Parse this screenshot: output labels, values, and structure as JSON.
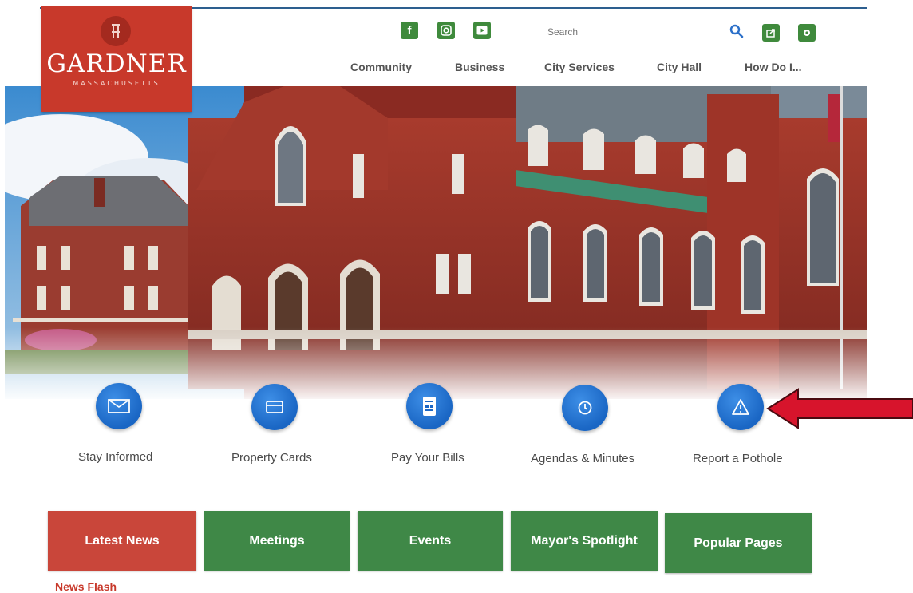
{
  "logo": {
    "name": "GARDNER",
    "state": "MASSACHUSETTS"
  },
  "social": [
    {
      "icon": "facebook-icon",
      "glyph": "f"
    },
    {
      "icon": "instagram-icon",
      "glyph": "◙"
    },
    {
      "icon": "youtube-icon",
      "glyph": "▶"
    }
  ],
  "search": {
    "placeholder": "Search"
  },
  "nav": [
    "Community",
    "Business",
    "City Services",
    "City Hall",
    "How Do I..."
  ],
  "quick_links": [
    {
      "label": "Stay Informed",
      "icon": "envelope-icon"
    },
    {
      "label": "Property Cards",
      "icon": "card-icon"
    },
    {
      "label": "Pay Your Bills",
      "icon": "bill-icon"
    },
    {
      "label": "Agendas & Minutes",
      "icon": "clock-icon"
    },
    {
      "label": "Report a Pothole",
      "icon": "warning-icon"
    }
  ],
  "tabs": [
    "Latest News",
    "Meetings",
    "Events",
    "Mayor's Spotlight",
    "Popular Pages"
  ],
  "news_flash": "News Flash",
  "colors": {
    "brand_red": "#c8392b",
    "accent_green": "#3f8847",
    "accent_blue": "#1a66c4",
    "arrow_red": "#d7142c"
  }
}
